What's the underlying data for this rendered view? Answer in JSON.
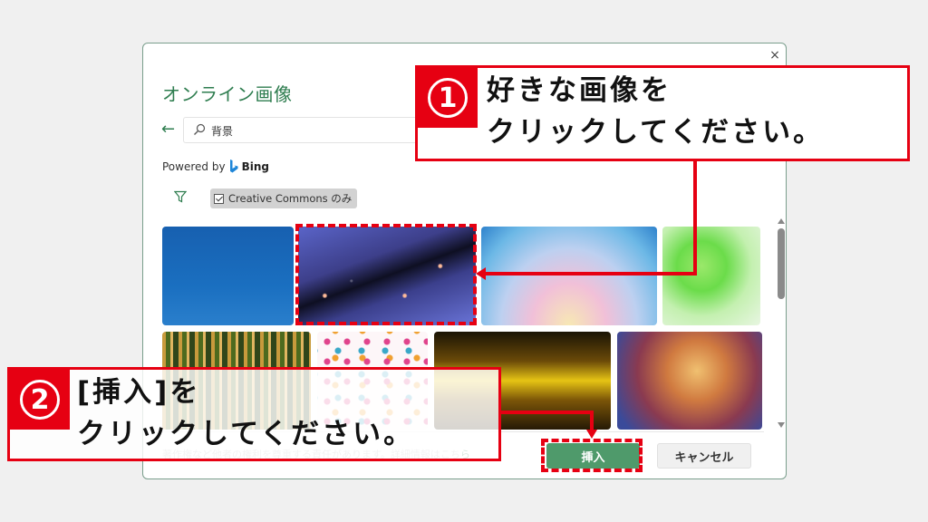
{
  "dialog": {
    "title": "オンライン画像",
    "close_label": "×",
    "feedback": {
      "positive": "smile-icon",
      "negative": "frown-icon"
    },
    "search": {
      "value": "背景",
      "placeholder": ""
    },
    "powered_by": {
      "prefix": "Powered by",
      "brand": "Bing"
    },
    "filter": {
      "icon": "filter-icon",
      "creative_commons_label": "Creative Commons のみ",
      "creative_commons_checked": true
    },
    "images": [
      {
        "name": "blue-sky",
        "selected": false
      },
      {
        "name": "galaxy-nebula",
        "selected": true
      },
      {
        "name": "pastel-watercolor",
        "selected": false
      },
      {
        "name": "green-watercolor",
        "selected": false
      },
      {
        "name": "bamboo-stripes",
        "selected": false
      },
      {
        "name": "flower-pattern",
        "selected": false
      },
      {
        "name": "golden-light",
        "selected": false
      },
      {
        "name": "colorful-texture",
        "selected": false
      }
    ],
    "footer": {
      "note": "著作権など他者の権利を尊重する責任があります。詳細情報はこち",
      "link": "ら"
    },
    "buttons": {
      "insert": "挿入",
      "cancel": "キャンセル"
    }
  },
  "annotations": {
    "callout_1": {
      "number": "①",
      "line1": "好きな画像を",
      "line2": "クリックしてください。"
    },
    "callout_2": {
      "number": "②",
      "line1": "[挿入]を",
      "line2": "クリックしてください。"
    },
    "accent_color": "#e60012"
  }
}
